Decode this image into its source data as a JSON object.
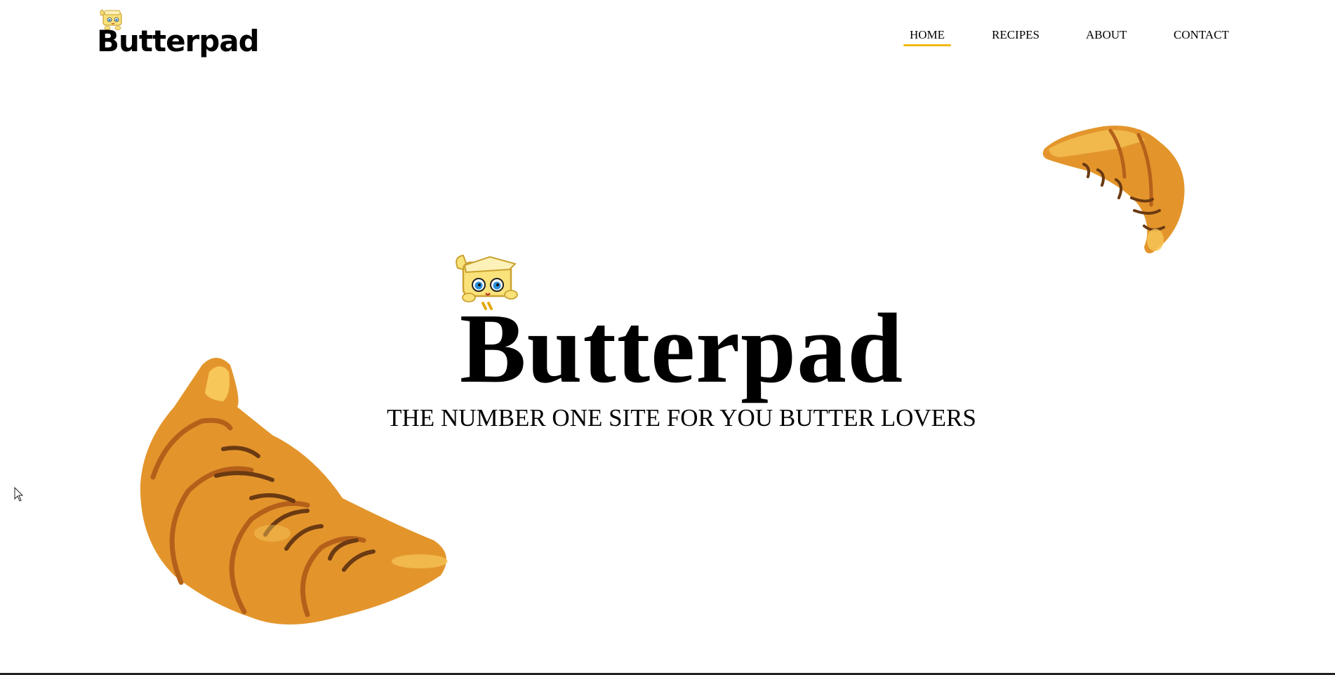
{
  "brand": {
    "name": "Butterpad"
  },
  "nav": {
    "items": [
      {
        "label": "HOME",
        "active": true
      },
      {
        "label": "RECIPES",
        "active": false
      },
      {
        "label": "ABOUT",
        "active": false
      },
      {
        "label": "CONTACT",
        "active": false
      }
    ]
  },
  "hero": {
    "title": "Butterpad",
    "tagline": "THE NUMBER ONE SITE FOR YOU BUTTER LOVERS"
  },
  "colors": {
    "nav_active_underline": "#f1b80f",
    "croissant_base": "#e3952c",
    "croissant_highlight": "#f7c75a",
    "croissant_stripe": "#6b3a12",
    "mascot_yellow": "#f9e27a"
  },
  "icons": {
    "logo": "butter-mascot-icon",
    "hero_mascot": "butter-mascot-icon",
    "decorations": [
      "croissant-icon",
      "croissant-icon"
    ],
    "cursor": "mouse-cursor-icon"
  }
}
